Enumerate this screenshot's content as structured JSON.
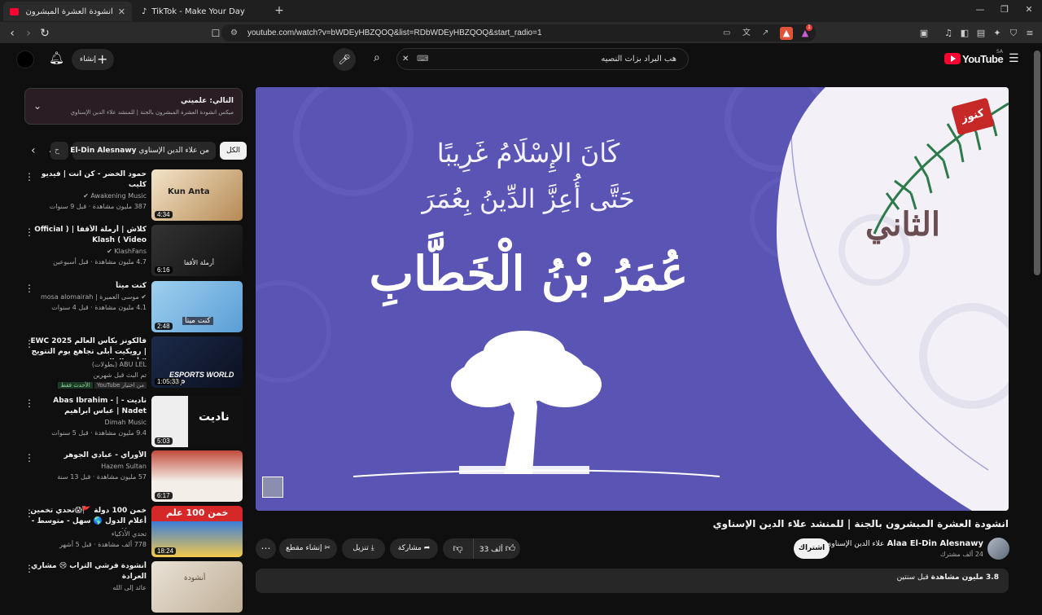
{
  "browser": {
    "tabs": [
      {
        "title": "انشودة العشرة المبشرون بالجنة | لل",
        "active": true
      },
      {
        "title": "TikTok - Make Your Day",
        "active": false
      }
    ],
    "new_tab": "+",
    "url": "youtube.com/watch?v=bWDEyHBZQOQ&list=RDbWDEyHBZQOQ&start_radio=1",
    "ext_badge": "1"
  },
  "youtube": {
    "logo": "YouTube",
    "region": "SA",
    "search_value": "هب البراد بزات النصيه",
    "create_label": "إنشاء"
  },
  "player": {
    "line1": "كَانَ الإِسْلَامُ غَرِيبًا",
    "line2": "حَتَّى أُعِزَّ الدِّينُ بِعُمَرَ",
    "name": "عُمَرُ بْنُ الْخَطَّابِ",
    "side_word": "الثاني",
    "logo_text": "كنوز"
  },
  "mix": {
    "next_label": "التالي: علميني",
    "subtitle": "ميكس انشودة العشرة المبشرون بالجنة | للمنشد علاء الدين الإسناوي"
  },
  "chips": {
    "all": "الكل",
    "from_channel": "من علاء الدين الإسناوي",
    "channel_en": "Alaa El-Din Alesnawy",
    "more": "ح"
  },
  "videos": [
    {
      "title": "حمود الخضر - كن انت | فيديو كليب",
      "channel": "Awakening Music",
      "stats": "387 مليون مشاهدة · قبل 9 سنوات",
      "duration": "4:34",
      "thumb_text": "Kun Anta"
    },
    {
      "title": "كلاش | أرملة الأقفا | ( Official Video ) Klash",
      "channel": "KlashFans",
      "stats": "4.7 مليون مشاهدة · قبل أسبوعين",
      "duration": "6:16",
      "thumb_text": "أرملة الأقفا"
    },
    {
      "title": "كنت ميتاً",
      "channel": "موسى العميرة | mosa alomairah",
      "stats": "4.1 مليون مشاهدة · قبل 4 سنوات",
      "duration": "2:48",
      "thumb_text": "كنت ميتا"
    },
    {
      "title": "فالكونز بكأس العالم EWC 2025 | رويكيت أبلى تجاهع يوم التتويج لكأس العالم",
      "channel": "ABU LEL (بطولات)",
      "stats": "تم البث قبل شهرين",
      "duration": "1:05:33",
      "thumb_text": "ESPORTS WORLD CUP",
      "badge_new": "الأحدث فقط",
      "badge_src": "من اختيار YouTube"
    },
    {
      "title": "ناديت - | Abas Ibrahim - Nadet | عباس ابراهيم",
      "channel": "Dimah Music",
      "stats": "9.4 مليون مشاهدة · قبل 5 سنوات",
      "duration": "5:03",
      "thumb_text": "ناديت"
    },
    {
      "title": "الأوراي - عبادي الجوهر",
      "channel": "Hazem Sultan",
      "stats": "57 مليون مشاهدة · قبل 13 سنة",
      "duration": "6:17",
      "thumb_text": ""
    },
    {
      "title": "خمن 100 دولة 🚩😱تحدي تخمين أعلام الدول 🌎 سهل - متوسط - صعب!!",
      "channel": "تحدي الأذكياء",
      "stats": "778 ألف مشاهدة · قبل 5 أشهر",
      "duration": "18:24",
      "thumb_text": "خمن 100 علم"
    },
    {
      "title": "أنشودة فرشي التراب 😢 مشاري العرادة",
      "channel": "عائد إلى الله",
      "stats": "",
      "duration": "",
      "thumb_text": "أنشودة"
    }
  ],
  "watch": {
    "title": "انشودة العشرة المبشرون بالجنة | للمنشد علاء الدين الإسناوي",
    "channel_en": "Alaa El-Din Alesnawy",
    "channel_ar": "علاء الدين الإسناوي",
    "subs": "24 ألف مشترك",
    "subscribe": "اشتراك",
    "likes": "33 ألف",
    "share": "مشاركة",
    "download": "تنزيل",
    "clip": "إنشاء مقطع",
    "views": "3.8 مليون مشاهدة",
    "age": "قبل سنتين"
  }
}
